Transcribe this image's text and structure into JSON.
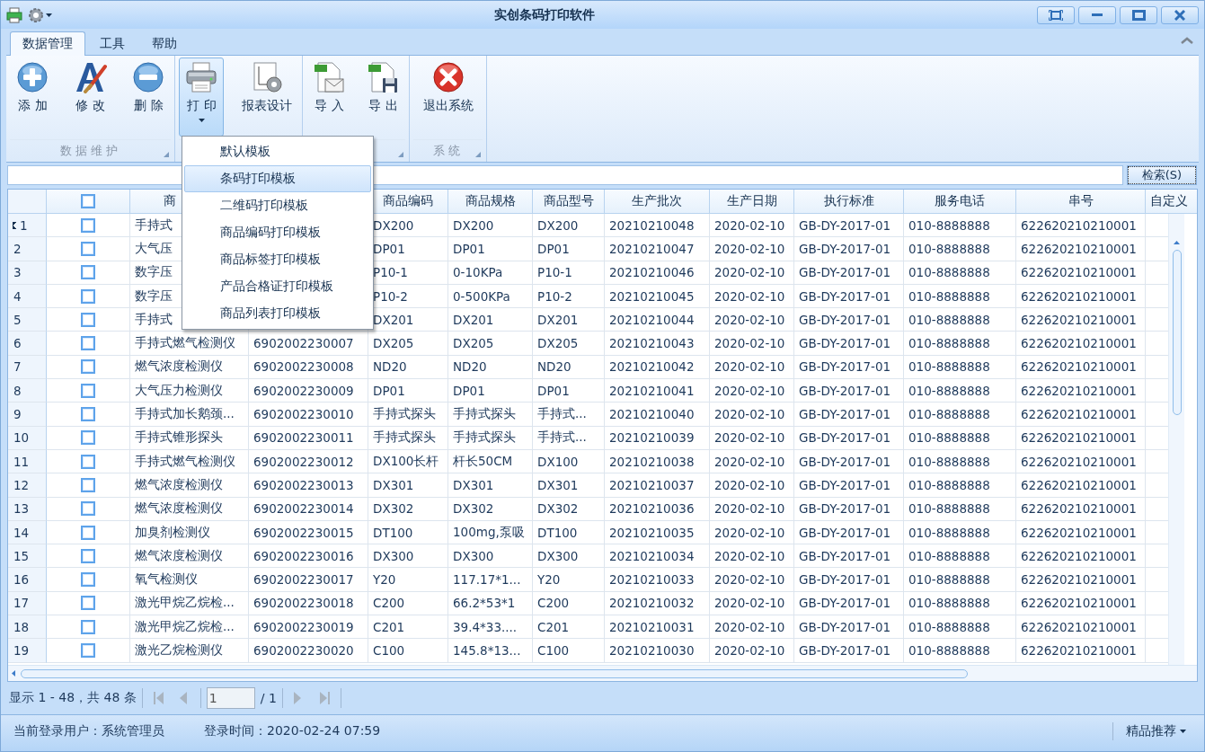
{
  "window": {
    "title": "实创条码打印软件"
  },
  "ribbon": {
    "tabs": [
      {
        "label": "数据管理",
        "selected": true
      },
      {
        "label": "工具",
        "selected": false
      },
      {
        "label": "帮助",
        "selected": false
      }
    ],
    "groups": [
      {
        "label": "数据维护",
        "launcher": true,
        "buttons": [
          {
            "kind": "add",
            "label": "添加",
            "selected": false,
            "dropdown": false
          },
          {
            "kind": "edit",
            "label": "修改",
            "selected": false,
            "dropdown": false
          },
          {
            "kind": "delete",
            "label": "删除",
            "selected": false,
            "dropdown": false
          }
        ]
      },
      {
        "launcher": false,
        "buttons": [
          {
            "kind": "print",
            "label": "打印",
            "selected": true,
            "dropdown": true
          },
          {
            "kind": "report",
            "label": "报表设计",
            "selected": false,
            "dropdown": false
          }
        ]
      },
      {
        "launcher": true,
        "buttons": [
          {
            "kind": "import",
            "label": "导入",
            "selected": false,
            "dropdown": false
          },
          {
            "kind": "export",
            "label": "导出",
            "selected": false,
            "dropdown": false
          }
        ]
      },
      {
        "label": "系统",
        "launcher": true,
        "buttons": [
          {
            "kind": "exit",
            "label": "退出系统",
            "selected": false,
            "dropdown": false
          }
        ]
      }
    ]
  },
  "print_menu": {
    "items": [
      {
        "label": "默认模板",
        "selected": false
      },
      {
        "label": "条码打印模板",
        "selected": true
      },
      {
        "label": "二维码打印模板",
        "selected": false
      },
      {
        "label": "商品编码打印模板",
        "selected": false
      },
      {
        "label": "商品标签打印模板",
        "selected": false
      },
      {
        "label": "产品合格证打印模板",
        "selected": false
      },
      {
        "label": "商品列表打印模板",
        "selected": false
      }
    ]
  },
  "search": {
    "button": "检索(S)"
  },
  "table": {
    "header_checkbox": {
      "checked": false
    },
    "columns": [
      {
        "kind": "text",
        "label": "商"
      },
      {
        "kind": "text"
      },
      {
        "kind": "text",
        "label": "商品编码"
      },
      {
        "kind": "text",
        "label": "商品规格"
      },
      {
        "kind": "text",
        "label": "商品型号"
      },
      {
        "kind": "text",
        "label": "生产批次"
      },
      {
        "kind": "text",
        "label": "生产日期"
      },
      {
        "kind": "text",
        "label": "执行标准"
      },
      {
        "kind": "text",
        "label": "服务电话"
      },
      {
        "kind": "text",
        "label": "串号"
      },
      {
        "kind": "text",
        "label": "自定义"
      }
    ],
    "rows": [
      {
        "number": "1",
        "current": true,
        "checked": false,
        "cells": [
          "手持式",
          null,
          "DX200",
          "DX200",
          "DX200",
          "20210210048",
          "2020-02-10",
          "GB-DY-2017-01",
          "010-8888888",
          "622620210210001"
        ]
      },
      {
        "number": "2",
        "current": false,
        "checked": false,
        "cells": [
          "大气压",
          null,
          "DP01",
          "DP01",
          "DP01",
          "20210210047",
          "2020-02-10",
          "GB-DY-2017-01",
          "010-8888888",
          "622620210210001"
        ]
      },
      {
        "number": "3",
        "current": false,
        "checked": false,
        "cells": [
          "数字压",
          null,
          "P10-1",
          "0-10KPa",
          "P10-1",
          "20210210046",
          "2020-02-10",
          "GB-DY-2017-01",
          "010-8888888",
          "622620210210001"
        ]
      },
      {
        "number": "4",
        "current": false,
        "checked": false,
        "cells": [
          "数字压",
          null,
          "P10-2",
          "0-500KPa",
          "P10-2",
          "20210210045",
          "2020-02-10",
          "GB-DY-2017-01",
          "010-8888888",
          "622620210210001"
        ]
      },
      {
        "number": "5",
        "current": false,
        "checked": false,
        "cells": [
          "手持式",
          null,
          "DX201",
          "DX201",
          "DX201",
          "20210210044",
          "2020-02-10",
          "GB-DY-2017-01",
          "010-8888888",
          "622620210210001"
        ]
      },
      {
        "number": "6",
        "current": false,
        "checked": false,
        "cells": [
          "手持式燃气检测仪",
          "6902002230007",
          "DX205",
          "DX205",
          "DX205",
          "20210210043",
          "2020-02-10",
          "GB-DY-2017-01",
          "010-8888888",
          "622620210210001"
        ]
      },
      {
        "number": "7",
        "current": false,
        "checked": false,
        "cells": [
          "燃气浓度检测仪",
          "6902002230008",
          "ND20",
          "ND20",
          "ND20",
          "20210210042",
          "2020-02-10",
          "GB-DY-2017-01",
          "010-8888888",
          "622620210210001"
        ]
      },
      {
        "number": "8",
        "current": false,
        "checked": false,
        "cells": [
          "大气压力检测仪",
          "6902002230009",
          "DP01",
          "DP01",
          "DP01",
          "20210210041",
          "2020-02-10",
          "GB-DY-2017-01",
          "010-8888888",
          "622620210210001"
        ]
      },
      {
        "number": "9",
        "current": false,
        "checked": false,
        "cells": [
          "手持式加长鹅颈...",
          "6902002230010",
          "手持式探头",
          "手持式探头",
          "手持式...",
          "20210210040",
          "2020-02-10",
          "GB-DY-2017-01",
          "010-8888888",
          "622620210210001"
        ]
      },
      {
        "number": "10",
        "current": false,
        "checked": false,
        "cells": [
          "手持式锥形探头",
          "6902002230011",
          "手持式探头",
          "手持式探头",
          "手持式...",
          "20210210039",
          "2020-02-10",
          "GB-DY-2017-01",
          "010-8888888",
          "622620210210001"
        ]
      },
      {
        "number": "11",
        "current": false,
        "checked": false,
        "cells": [
          "手持式燃气检测仪",
          "6902002230012",
          "DX100长杆",
          "杆长50CM",
          "DX100",
          "20210210038",
          "2020-02-10",
          "GB-DY-2017-01",
          "010-8888888",
          "622620210210001"
        ]
      },
      {
        "number": "12",
        "current": false,
        "checked": false,
        "cells": [
          "燃气浓度检测仪",
          "6902002230013",
          "DX301",
          "DX301",
          "DX301",
          "20210210037",
          "2020-02-10",
          "GB-DY-2017-01",
          "010-8888888",
          "622620210210001"
        ]
      },
      {
        "number": "13",
        "current": false,
        "checked": false,
        "cells": [
          "燃气浓度检测仪",
          "6902002230014",
          "DX302",
          "DX302",
          "DX302",
          "20210210036",
          "2020-02-10",
          "GB-DY-2017-01",
          "010-8888888",
          "622620210210001"
        ]
      },
      {
        "number": "14",
        "current": false,
        "checked": false,
        "cells": [
          "加臭剂检测仪",
          "6902002230015",
          "DT100",
          "100mg,泵吸",
          "DT100",
          "20210210035",
          "2020-02-10",
          "GB-DY-2017-01",
          "010-8888888",
          "622620210210001"
        ]
      },
      {
        "number": "15",
        "current": false,
        "checked": false,
        "cells": [
          "燃气浓度检测仪",
          "6902002230016",
          "DX300",
          "DX300",
          "DX300",
          "20210210034",
          "2020-02-10",
          "GB-DY-2017-01",
          "010-8888888",
          "622620210210001"
        ]
      },
      {
        "number": "16",
        "current": false,
        "checked": false,
        "cells": [
          "氧气检测仪",
          "6902002230017",
          "Y20",
          "117.17*1...",
          "Y20",
          "20210210033",
          "2020-02-10",
          "GB-DY-2017-01",
          "010-8888888",
          "622620210210001"
        ]
      },
      {
        "number": "17",
        "current": false,
        "checked": false,
        "cells": [
          "激光甲烷乙烷检...",
          "6902002230018",
          "C200",
          "66.2*53*1",
          "C200",
          "20210210032",
          "2020-02-10",
          "GB-DY-2017-01",
          "010-8888888",
          "622620210210001"
        ]
      },
      {
        "number": "18",
        "current": false,
        "checked": false,
        "cells": [
          "激光甲烷乙烷检...",
          "6902002230019",
          "C201",
          "39.4*33....",
          "C201",
          "20210210031",
          "2020-02-10",
          "GB-DY-2017-01",
          "010-8888888",
          "622620210210001"
        ]
      },
      {
        "number": "19",
        "current": false,
        "checked": false,
        "cells": [
          "激光乙烷检测仪",
          "6902002230020",
          "C100",
          "145.8*13...",
          "C100",
          "20210210030",
          "2020-02-10",
          "GB-DY-2017-01",
          "010-8888888",
          "622620210210001"
        ]
      }
    ]
  },
  "pager": {
    "summary": "显示 1 - 48，共 48 条",
    "page": "1",
    "total": "/ 1",
    "buttons": [
      {
        "kind": "first",
        "disabled": true
      },
      {
        "kind": "prev",
        "disabled": true
      },
      {
        "kind": "next",
        "disabled": true
      },
      {
        "kind": "last",
        "disabled": true
      }
    ]
  },
  "status_bar": {
    "user": "当前登录用户：系统管理员",
    "login_time": "登录时间：2020-02-24 07:59",
    "recommend": "精品推荐"
  }
}
